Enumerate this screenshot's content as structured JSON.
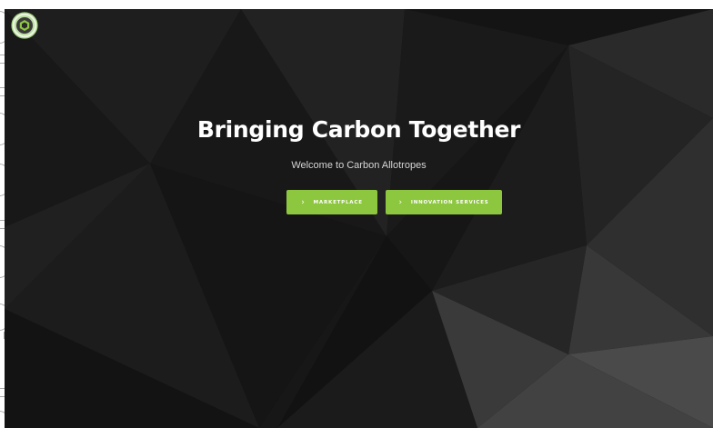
{
  "hero": {
    "title": "Bringing Carbon Together",
    "subtitle": "Welcome to Carbon Allotropes"
  },
  "buttons": {
    "marketplace_label": "MARKETPLACE",
    "innovation_label": "INNOVATION SERVICES",
    "chevron": "›"
  },
  "colors": {
    "accent": "#8dc63f",
    "background": "#111111",
    "logo_ring": "#b9dca0"
  },
  "icons": {
    "logo": "carbon-hexagon-logo",
    "button_chevron": "chevron-right-icon"
  }
}
